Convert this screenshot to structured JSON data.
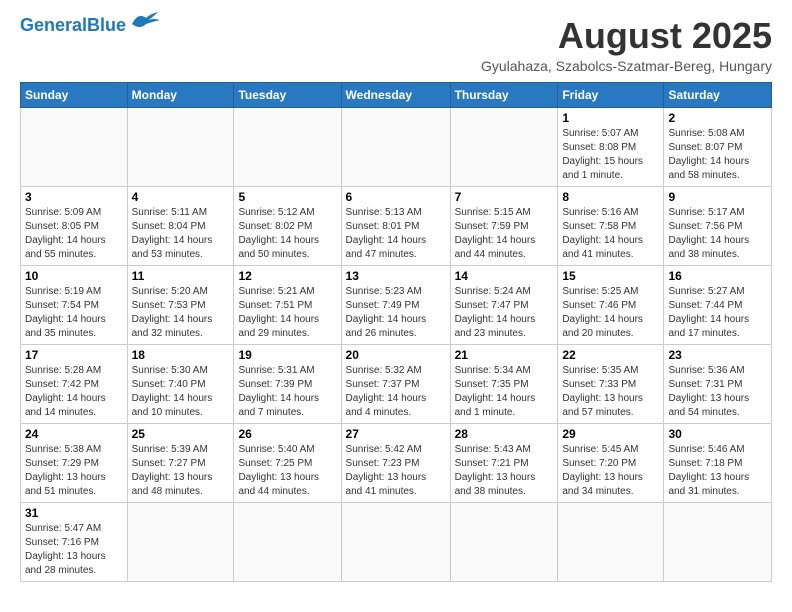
{
  "header": {
    "logo_general": "General",
    "logo_blue": "Blue",
    "title": "August 2025",
    "subtitle": "Gyulahaza, Szabolcs-Szatmar-Bereg, Hungary"
  },
  "weekdays": [
    "Sunday",
    "Monday",
    "Tuesday",
    "Wednesday",
    "Thursday",
    "Friday",
    "Saturday"
  ],
  "weeks": [
    [
      {
        "day": "",
        "info": ""
      },
      {
        "day": "",
        "info": ""
      },
      {
        "day": "",
        "info": ""
      },
      {
        "day": "",
        "info": ""
      },
      {
        "day": "",
        "info": ""
      },
      {
        "day": "1",
        "info": "Sunrise: 5:07 AM\nSunset: 8:08 PM\nDaylight: 15 hours and 1 minute."
      },
      {
        "day": "2",
        "info": "Sunrise: 5:08 AM\nSunset: 8:07 PM\nDaylight: 14 hours and 58 minutes."
      }
    ],
    [
      {
        "day": "3",
        "info": "Sunrise: 5:09 AM\nSunset: 8:05 PM\nDaylight: 14 hours and 55 minutes."
      },
      {
        "day": "4",
        "info": "Sunrise: 5:11 AM\nSunset: 8:04 PM\nDaylight: 14 hours and 53 minutes."
      },
      {
        "day": "5",
        "info": "Sunrise: 5:12 AM\nSunset: 8:02 PM\nDaylight: 14 hours and 50 minutes."
      },
      {
        "day": "6",
        "info": "Sunrise: 5:13 AM\nSunset: 8:01 PM\nDaylight: 14 hours and 47 minutes."
      },
      {
        "day": "7",
        "info": "Sunrise: 5:15 AM\nSunset: 7:59 PM\nDaylight: 14 hours and 44 minutes."
      },
      {
        "day": "8",
        "info": "Sunrise: 5:16 AM\nSunset: 7:58 PM\nDaylight: 14 hours and 41 minutes."
      },
      {
        "day": "9",
        "info": "Sunrise: 5:17 AM\nSunset: 7:56 PM\nDaylight: 14 hours and 38 minutes."
      }
    ],
    [
      {
        "day": "10",
        "info": "Sunrise: 5:19 AM\nSunset: 7:54 PM\nDaylight: 14 hours and 35 minutes."
      },
      {
        "day": "11",
        "info": "Sunrise: 5:20 AM\nSunset: 7:53 PM\nDaylight: 14 hours and 32 minutes."
      },
      {
        "day": "12",
        "info": "Sunrise: 5:21 AM\nSunset: 7:51 PM\nDaylight: 14 hours and 29 minutes."
      },
      {
        "day": "13",
        "info": "Sunrise: 5:23 AM\nSunset: 7:49 PM\nDaylight: 14 hours and 26 minutes."
      },
      {
        "day": "14",
        "info": "Sunrise: 5:24 AM\nSunset: 7:47 PM\nDaylight: 14 hours and 23 minutes."
      },
      {
        "day": "15",
        "info": "Sunrise: 5:25 AM\nSunset: 7:46 PM\nDaylight: 14 hours and 20 minutes."
      },
      {
        "day": "16",
        "info": "Sunrise: 5:27 AM\nSunset: 7:44 PM\nDaylight: 14 hours and 17 minutes."
      }
    ],
    [
      {
        "day": "17",
        "info": "Sunrise: 5:28 AM\nSunset: 7:42 PM\nDaylight: 14 hours and 14 minutes."
      },
      {
        "day": "18",
        "info": "Sunrise: 5:30 AM\nSunset: 7:40 PM\nDaylight: 14 hours and 10 minutes."
      },
      {
        "day": "19",
        "info": "Sunrise: 5:31 AM\nSunset: 7:39 PM\nDaylight: 14 hours and 7 minutes."
      },
      {
        "day": "20",
        "info": "Sunrise: 5:32 AM\nSunset: 7:37 PM\nDaylight: 14 hours and 4 minutes."
      },
      {
        "day": "21",
        "info": "Sunrise: 5:34 AM\nSunset: 7:35 PM\nDaylight: 14 hours and 1 minute."
      },
      {
        "day": "22",
        "info": "Sunrise: 5:35 AM\nSunset: 7:33 PM\nDaylight: 13 hours and 57 minutes."
      },
      {
        "day": "23",
        "info": "Sunrise: 5:36 AM\nSunset: 7:31 PM\nDaylight: 13 hours and 54 minutes."
      }
    ],
    [
      {
        "day": "24",
        "info": "Sunrise: 5:38 AM\nSunset: 7:29 PM\nDaylight: 13 hours and 51 minutes."
      },
      {
        "day": "25",
        "info": "Sunrise: 5:39 AM\nSunset: 7:27 PM\nDaylight: 13 hours and 48 minutes."
      },
      {
        "day": "26",
        "info": "Sunrise: 5:40 AM\nSunset: 7:25 PM\nDaylight: 13 hours and 44 minutes."
      },
      {
        "day": "27",
        "info": "Sunrise: 5:42 AM\nSunset: 7:23 PM\nDaylight: 13 hours and 41 minutes."
      },
      {
        "day": "28",
        "info": "Sunrise: 5:43 AM\nSunset: 7:21 PM\nDaylight: 13 hours and 38 minutes."
      },
      {
        "day": "29",
        "info": "Sunrise: 5:45 AM\nSunset: 7:20 PM\nDaylight: 13 hours and 34 minutes."
      },
      {
        "day": "30",
        "info": "Sunrise: 5:46 AM\nSunset: 7:18 PM\nDaylight: 13 hours and 31 minutes."
      }
    ],
    [
      {
        "day": "31",
        "info": "Sunrise: 5:47 AM\nSunset: 7:16 PM\nDaylight: 13 hours and 28 minutes."
      },
      {
        "day": "",
        "info": ""
      },
      {
        "day": "",
        "info": ""
      },
      {
        "day": "",
        "info": ""
      },
      {
        "day": "",
        "info": ""
      },
      {
        "day": "",
        "info": ""
      },
      {
        "day": "",
        "info": ""
      }
    ]
  ]
}
